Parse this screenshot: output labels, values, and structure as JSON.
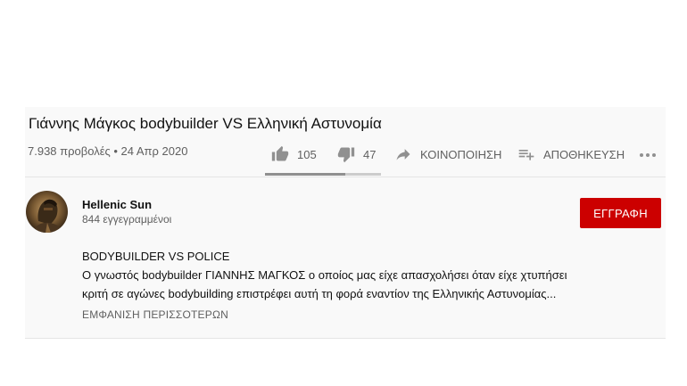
{
  "video": {
    "title": "Γιάννης Μάγκος bodybuilder VS Ελληνική Αστυνομία",
    "meta": "7.938 προβολές • 24 Απρ 2020"
  },
  "actions": {
    "like_count": "105",
    "dislike_count": "47",
    "share_label": "ΚΟΙΝΟΠΟΙΗΣΗ",
    "save_label": "ΑΠΟΘΗΚΕΥΣΗ",
    "like_ratio": 0.69
  },
  "channel": {
    "name": "Hellenic Sun",
    "subscribers": "844 εγγεγραμμένοι",
    "subscribe_label": "ΕΓΓΡΑΦΗ"
  },
  "description": {
    "line1": "BODYBUILDER VS POLICE",
    "line2": "Ο γνωστός bodybuilder ΓΙΑΝΝΗΣ ΜΑΓΚΟΣ ο οποίος μας είχε απασχολήσει όταν είχε χτυπήσει",
    "line3": "κριτή σε αγώνες bodybuilding επιστρέφει αυτή τη φορά εναντίον της Ελληνικής Αστυνομίας...",
    "show_more": "ΕΜΦΑΝΙΣΗ ΠΕΡΙΣΣΟΤΕΡΩΝ"
  },
  "icons": {
    "like": "thumbs-up-icon",
    "dislike": "thumbs-down-icon",
    "share": "share-arrow-icon",
    "save": "playlist-add-icon",
    "more": "more-dots-icon"
  },
  "colors": {
    "subscribe_bg": "#cc0000",
    "secondary_text": "#606060",
    "panel_bg": "#f9f9f9"
  }
}
